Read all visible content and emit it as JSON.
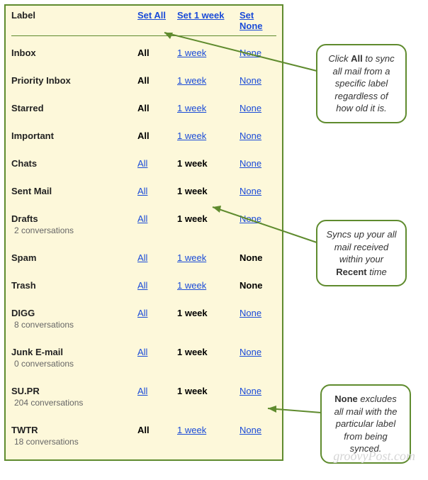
{
  "header": {
    "label": "Label",
    "set_all": "Set All",
    "set_week": "Set 1 week",
    "set_none": "Set None"
  },
  "option_labels": {
    "all": "All",
    "week": "1 week",
    "none": "None"
  },
  "rows": [
    {
      "name": "Inbox",
      "sub": "",
      "selected": "all"
    },
    {
      "name": "Priority Inbox",
      "sub": "",
      "selected": "all"
    },
    {
      "name": "Starred",
      "sub": "",
      "selected": "all"
    },
    {
      "name": "Important",
      "sub": "",
      "selected": "all"
    },
    {
      "name": "Chats",
      "sub": "",
      "selected": "week"
    },
    {
      "name": "Sent Mail",
      "sub": "",
      "selected": "week"
    },
    {
      "name": "Drafts",
      "sub": "2 conversations",
      "selected": "week"
    },
    {
      "name": "Spam",
      "sub": "",
      "selected": "none"
    },
    {
      "name": "Trash",
      "sub": "",
      "selected": "none"
    },
    {
      "name": "DIGG",
      "sub": "8 conversations",
      "selected": "week"
    },
    {
      "name": "Junk E-mail",
      "sub": "0 conversations",
      "selected": "week"
    },
    {
      "name": "SU.PR",
      "sub": "204 conversations",
      "selected": "week"
    },
    {
      "name": "TWTR",
      "sub": "18 conversations",
      "selected": "all"
    }
  ],
  "callouts": {
    "c1": {
      "pre": "Click ",
      "bold": "All",
      "post": " to sync all mail from a specific label regardless of how old it is."
    },
    "c2": {
      "pre": "Syncs",
      "mid": " up your all mail received within your ",
      "bold": "Recent",
      "post": " time"
    },
    "c3": {
      "bold": "None",
      "post": " excludes all mail with the particular label from being synced."
    }
  },
  "watermark": "groovyPost.com"
}
